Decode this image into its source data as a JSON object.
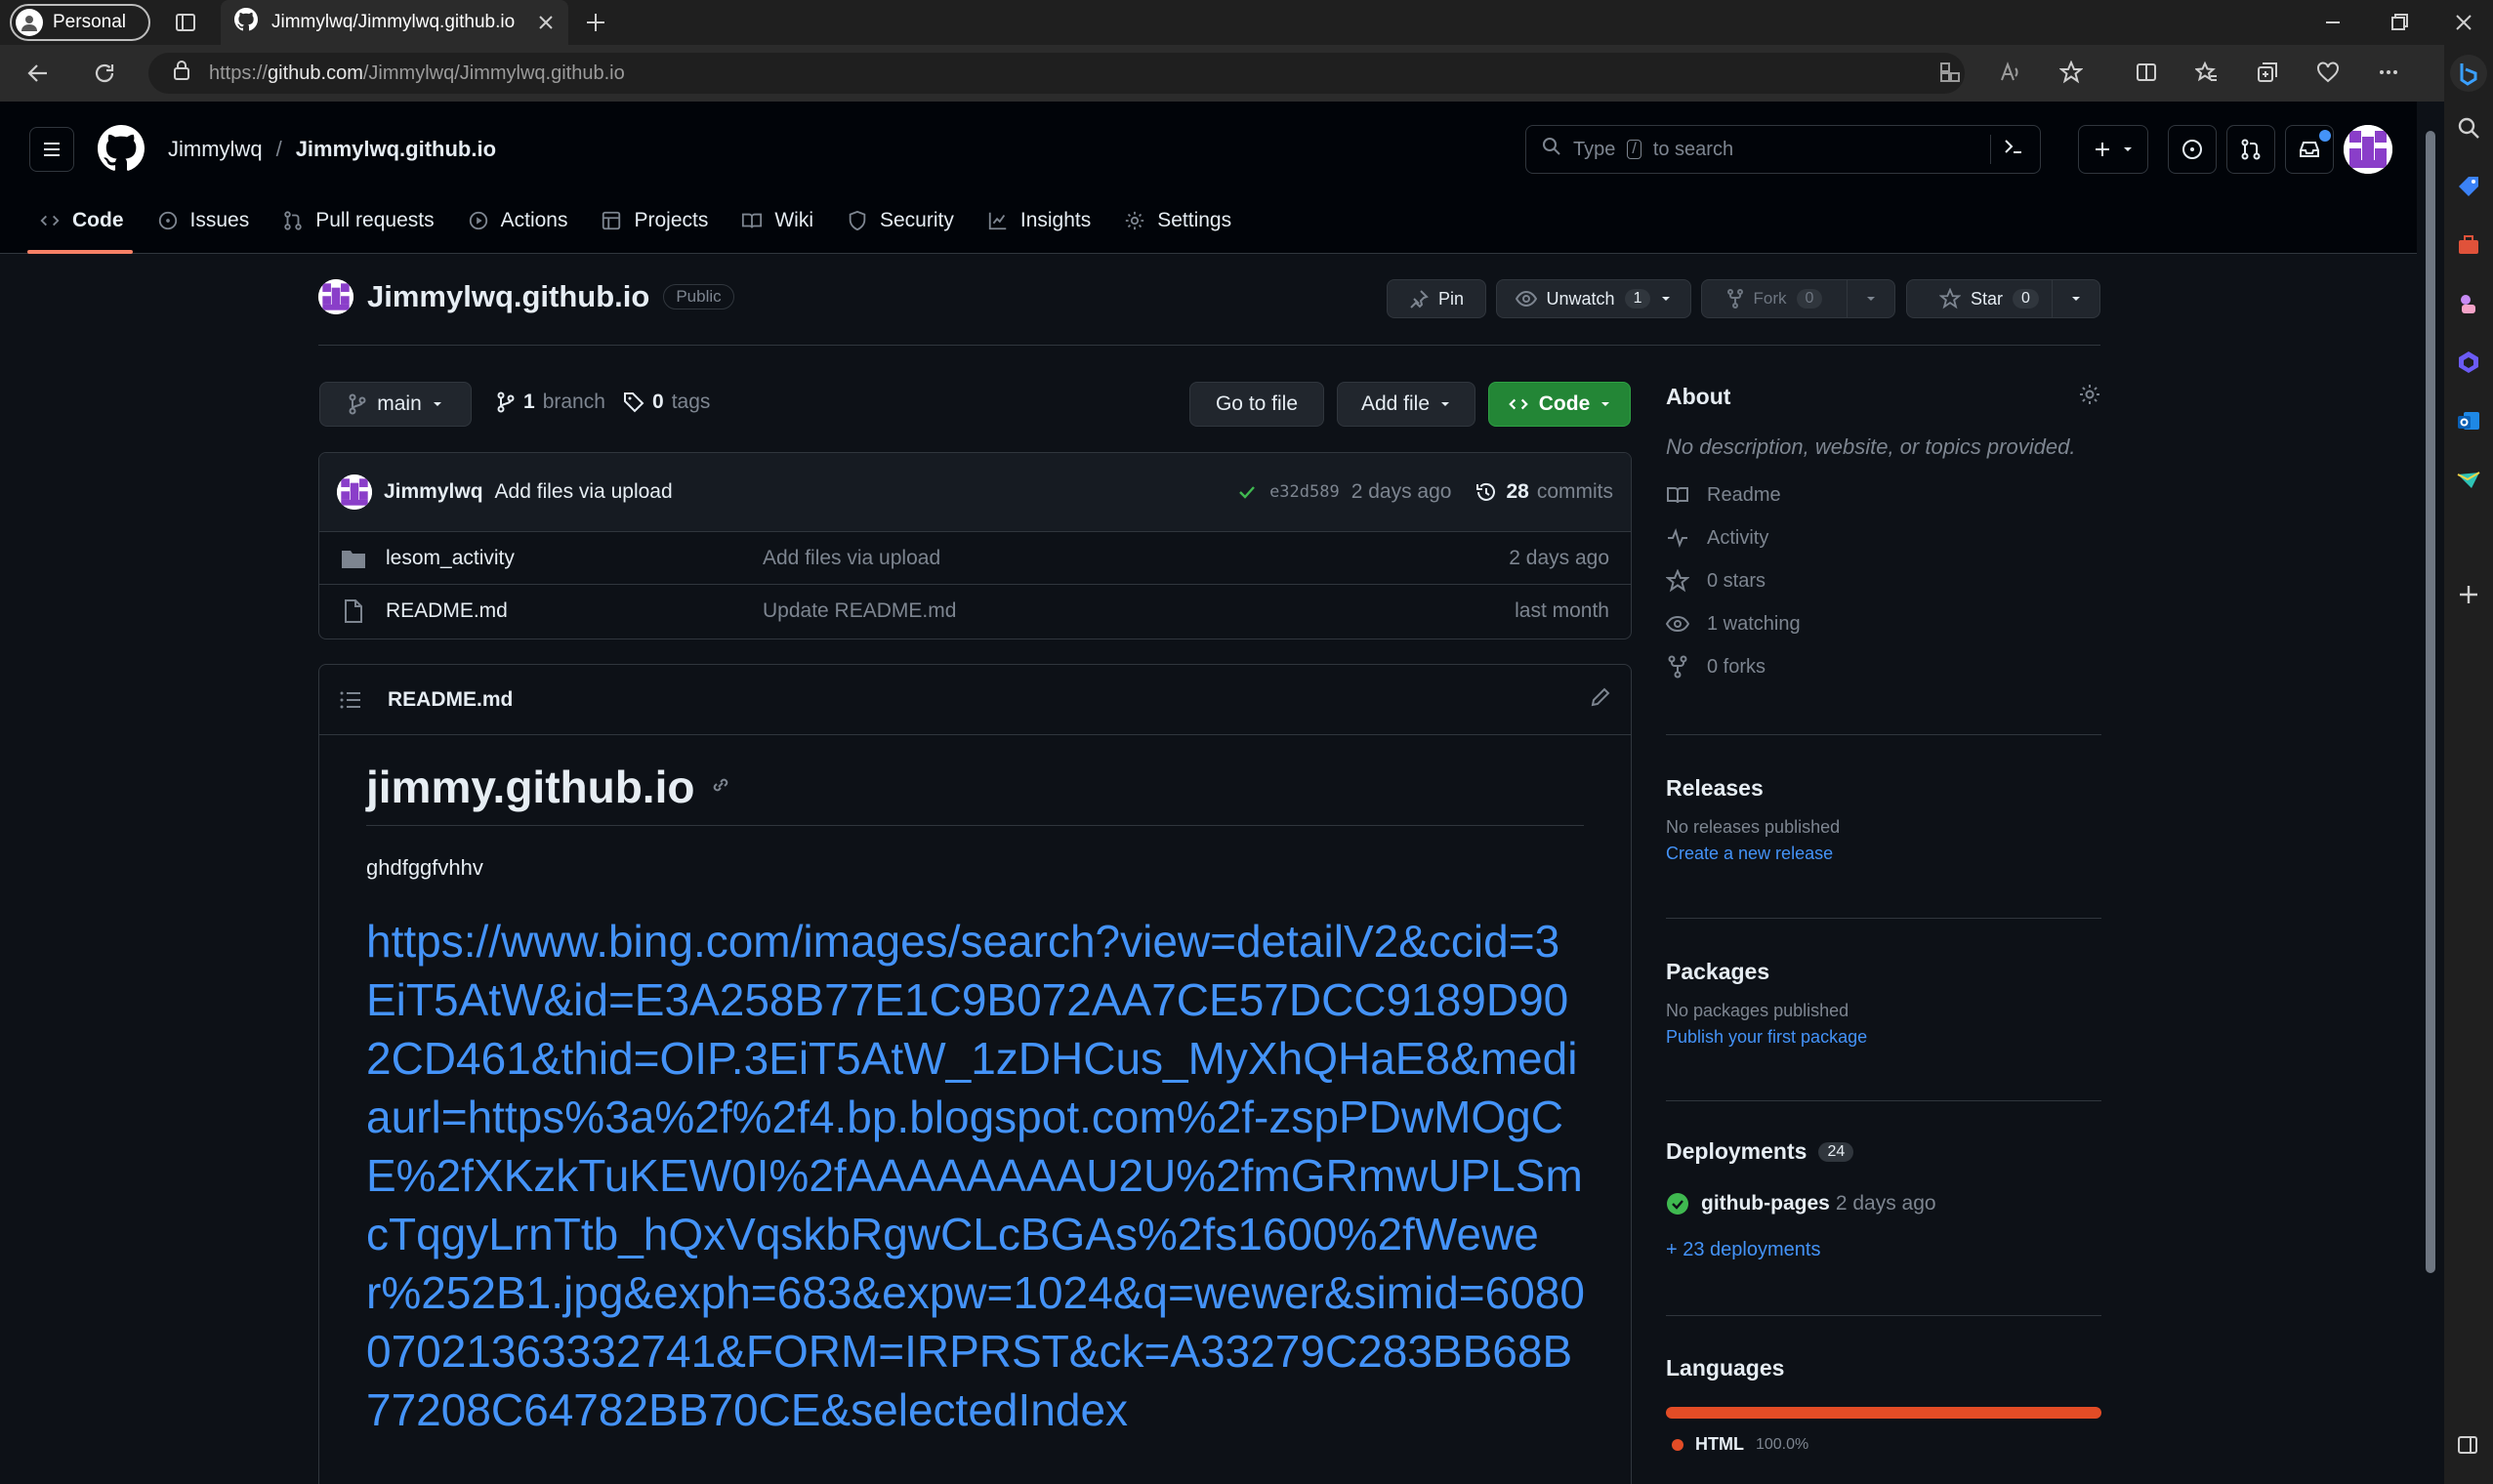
{
  "browser": {
    "profile_label": "Personal",
    "tab_title": "Jimmylwq/Jimmylwq.github.io",
    "url_prefix": "https://",
    "url_host": "github.com",
    "url_path": "/Jimmylwq/Jimmylwq.github.io"
  },
  "header": {
    "owner": "Jimmylwq",
    "separator": "/",
    "repo": "Jimmylwq.github.io",
    "search_prefix": "Type",
    "search_key": "/",
    "search_suffix": "to search"
  },
  "nav": {
    "tabs": [
      {
        "label": "Code"
      },
      {
        "label": "Issues"
      },
      {
        "label": "Pull requests"
      },
      {
        "label": "Actions"
      },
      {
        "label": "Projects"
      },
      {
        "label": "Wiki"
      },
      {
        "label": "Security"
      },
      {
        "label": "Insights"
      },
      {
        "label": "Settings"
      }
    ]
  },
  "repo": {
    "name": "Jimmylwq.github.io",
    "visibility": "Public",
    "pin_label": "Pin",
    "unwatch_label": "Unwatch",
    "watch_count": "1",
    "fork_label": "Fork",
    "fork_count": "0",
    "star_label": "Star",
    "star_count": "0"
  },
  "branchbar": {
    "branch": "main",
    "branch_count": "1",
    "branch_word": "branch",
    "tag_count": "0",
    "tag_word": "tags",
    "go_to_file": "Go to file",
    "add_file": "Add file",
    "code": "Code"
  },
  "commit": {
    "author": "Jimmylwq",
    "message": "Add files via upload",
    "hash": "e32d589",
    "time": "2 days ago",
    "commits_count": "28",
    "commits_word": "commits"
  },
  "files": [
    {
      "name": "lesom_activity",
      "message": "Add files via upload",
      "time": "2 days ago",
      "type": "folder"
    },
    {
      "name": "README.md",
      "message": "Update README.md",
      "time": "last month",
      "type": "file"
    }
  ],
  "readme": {
    "header": "README.md",
    "title": "jimmy.github.io",
    "body": "ghdfggfvhhv",
    "link": "https://www.bing.com/images/search?view=detailV2&ccid=3EiT5AtW&id=E3A258B77E1C9B072AA7CE57DCC9189D902CD461&thid=OIP.3EiT5AtW_1zDHCus_MyXhQHaE8&mediaurl=https%3a%2f%2f4.bp.blogspot.com%2f-zspPDwMOgCE%2fXKzkTuKEW0I%2fAAAAAAAAU2U%2fmGRmwUPLSmcTqgyLrnTtb_hQxVqskbRgwCLcBGAs%2fs1600%2fWewer%252B1.jpg&exph=683&expw=1024&q=wewer&simid=608007021363332741&FORM=IRPRST&ck=A33279C283BB68B77208C64782BB70CE&selectedIndex"
  },
  "about": {
    "title": "About",
    "description": "No description, website, or topics provided.",
    "items": [
      {
        "label": "Readme"
      },
      {
        "label": "Activity"
      },
      {
        "label": "0 stars"
      },
      {
        "label": "1 watching"
      },
      {
        "label": "0 forks"
      }
    ]
  },
  "releases": {
    "title": "Releases",
    "empty": "No releases published",
    "link": "Create a new release"
  },
  "packages": {
    "title": "Packages",
    "empty": "No packages published",
    "link": "Publish your first package"
  },
  "deployments": {
    "title": "Deployments",
    "count": "24",
    "env": "github-pages",
    "time": "2 days ago",
    "more": "+ 23 deployments"
  },
  "languages": {
    "title": "Languages",
    "name": "HTML",
    "percent": "100.0%",
    "color": "#e34c26"
  },
  "colors": {
    "accent_green": "#238636",
    "link_blue": "#4493f8",
    "active_tab_underline": "#f78166"
  }
}
